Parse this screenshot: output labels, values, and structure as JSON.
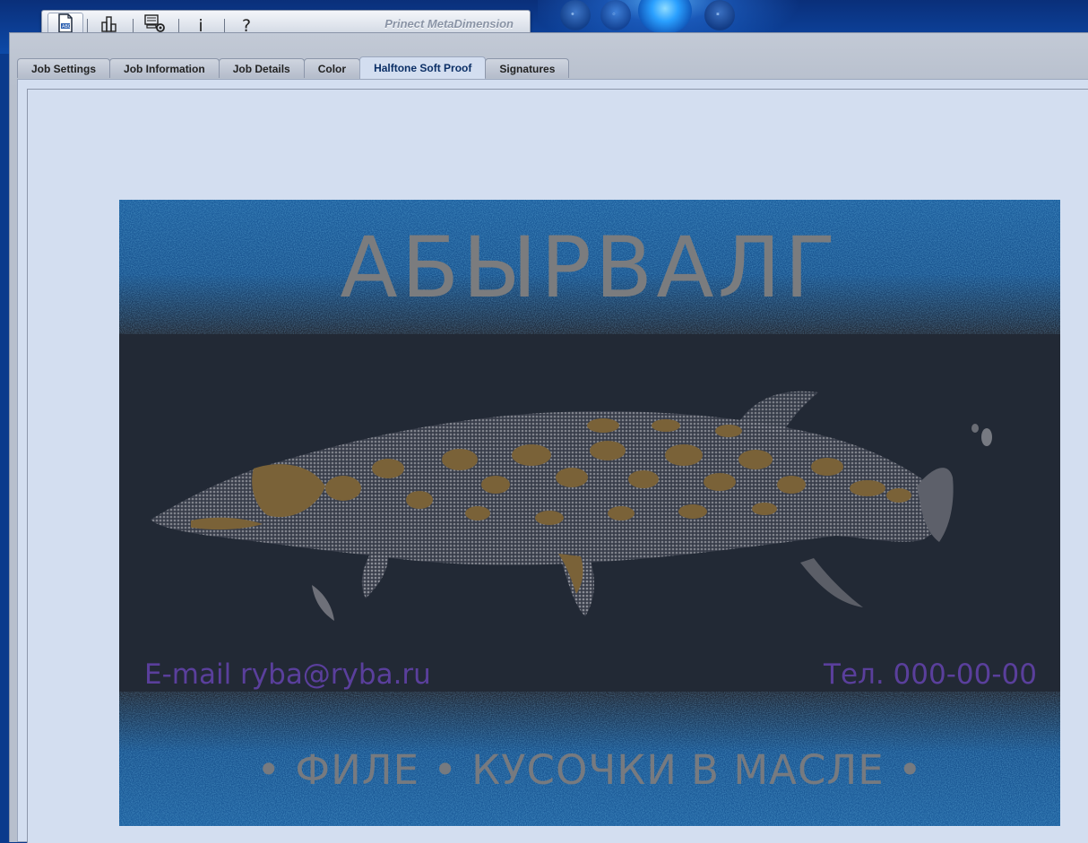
{
  "app": {
    "brand": "Prinect MetaDimension"
  },
  "toolbar": {
    "buttons": [
      {
        "icon": "job-document-icon",
        "active": true
      },
      {
        "icon": "statistics-icon",
        "active": false
      },
      {
        "icon": "system-settings-icon",
        "active": false
      },
      {
        "icon": "info-icon",
        "label": "i",
        "active": false
      },
      {
        "icon": "help-icon",
        "label": "?",
        "active": false
      }
    ]
  },
  "tabs": [
    {
      "label": "Job Settings",
      "active": false
    },
    {
      "label": "Job Information",
      "active": false
    },
    {
      "label": "Job Details",
      "active": false
    },
    {
      "label": "Color",
      "active": false
    },
    {
      "label": "Halftone Soft Proof",
      "active": true
    },
    {
      "label": "Signatures",
      "active": false
    }
  ],
  "proof": {
    "title": "АБЫРВАЛГ",
    "email": "E-mail ryba@ryba.ru",
    "phone": "Тел. 000-00-00",
    "tagline": "• ФИЛЕ • КУСОЧКИ В МАСЛЕ •",
    "colors": {
      "band": "#1d5f9e",
      "background": "#222935",
      "title": "#7b7c7e",
      "contact": "#5a3f9c",
      "fish_spots": "#7a6238",
      "fish_body": "#6b6e78"
    }
  }
}
